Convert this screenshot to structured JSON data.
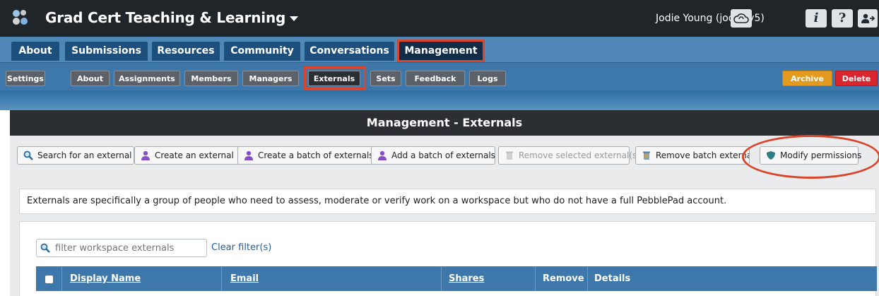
{
  "header": {
    "title": "Grad Cert Teaching & Learning",
    "user": "Jodie Young (jodie_v5)",
    "icons": [
      "cloud-icon",
      "info-icon",
      "help-icon",
      "logout-icon"
    ],
    "icon_glyphs": {
      "info": "i",
      "help": "?"
    }
  },
  "main_tabs": [
    "About",
    "Submissions",
    "Resources",
    "Community",
    "Conversations",
    "Management"
  ],
  "sub_tabs": [
    "Settings",
    "About",
    "Assignments",
    "Members",
    "Managers",
    "Externals",
    "Sets",
    "Feedback",
    "Logs"
  ],
  "sub_actions": {
    "archive": "Archive",
    "delete": "Delete"
  },
  "panel": {
    "title": "Management - Externals",
    "toolbar": [
      "Search for an external",
      "Create an external",
      "Create a batch of externals",
      "Add a batch of externals",
      "Remove selected external(s)",
      "Remove batch externals",
      "Modify permissions"
    ],
    "info": "Externals are specifically a group of people who need to assess, moderate or verify work on a workspace but who do not have a full PebblePad account.",
    "filter_placeholder": "filter workspace externals",
    "clear_filter": "Clear filter(s)",
    "columns": [
      "Display Name",
      "Email",
      "Shares",
      "Remove",
      "Details"
    ]
  },
  "colors": {
    "topbar": "#1f2528",
    "nav": "#4f87b6",
    "tab": "#1d4f7c",
    "highlight": "#d9442b",
    "archive": "#e39a1f",
    "delete": "#d9262e"
  }
}
